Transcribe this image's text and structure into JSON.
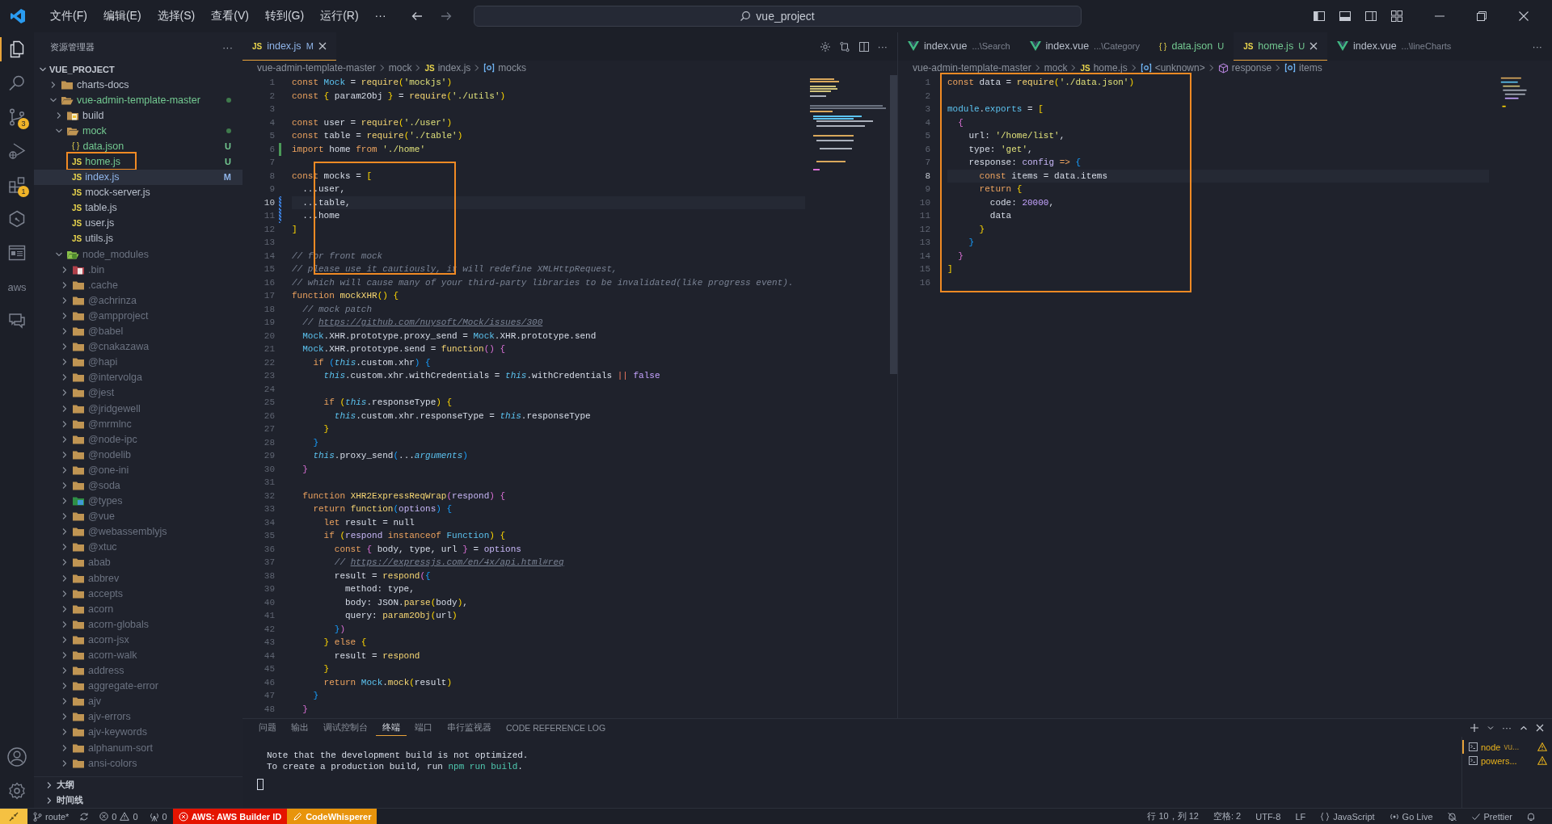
{
  "titlebar": {
    "menu": [
      {
        "label": "文件(F)"
      },
      {
        "label": "编辑(E)"
      },
      {
        "label": "选择(S)"
      },
      {
        "label": "查看(V)"
      },
      {
        "label": "转到(G)"
      },
      {
        "label": "运行(R)"
      },
      {
        "label": "···"
      }
    ],
    "command_center": "vue_project"
  },
  "activity": [
    {
      "kind": "files",
      "selected": true
    },
    {
      "kind": "search",
      "selected": false
    },
    {
      "kind": "source-control",
      "badge": "3",
      "selected": false
    },
    {
      "kind": "run",
      "selected": false
    },
    {
      "kind": "extensions",
      "badge": "1",
      "selected": false
    },
    {
      "kind": "hexagon",
      "selected": false
    },
    {
      "kind": "layout",
      "selected": false
    },
    {
      "kind": "aws",
      "label": "aws",
      "selected": false
    },
    {
      "kind": "chat",
      "selected": false
    }
  ],
  "activity_bottom": [
    {
      "kind": "account"
    },
    {
      "kind": "settings"
    }
  ],
  "sidebar": {
    "title": "资源管理器",
    "more": "···",
    "project": {
      "name": "VUE_PROJECT",
      "expanded": true
    },
    "tree": [
      {
        "name": "charts-docs",
        "kind": "folder",
        "expanded": false,
        "color": "#b8bfcb",
        "selected": false
      },
      {
        "name": "vue-admin-template-master",
        "kind": "folder",
        "expanded": true,
        "color": "#73c991",
        "dot": true,
        "selected": false,
        "children": [
          {
            "name": "build",
            "kind": "folder-build",
            "expanded": false,
            "color": "#b8bfcb",
            "selected": false
          },
          {
            "name": "mock",
            "kind": "folder",
            "expanded": true,
            "color": "#73c991",
            "dot": true,
            "selected": false,
            "children": [
              {
                "name": "data.json",
                "kind": "file",
                "glyph": "{ }",
                "color": "#73c991",
                "badge": "U",
                "selected": false
              },
              {
                "name": "home.js",
                "kind": "file",
                "glyph": "JS",
                "color": "#73c991",
                "badge": "U",
                "selected": false,
                "highlighted": true
              },
              {
                "name": "index.js",
                "kind": "file",
                "glyph": "JS",
                "color": "#8fb4e8",
                "badge": "M",
                "selected": true
              },
              {
                "name": "mock-server.js",
                "kind": "file",
                "glyph": "JS",
                "color": "#b8bfcb",
                "selected": false
              },
              {
                "name": "table.js",
                "kind": "file",
                "glyph": "JS",
                "color": "#b8bfcb",
                "selected": false
              },
              {
                "name": "user.js",
                "kind": "file",
                "glyph": "JS",
                "color": "#b8bfcb",
                "selected": false
              },
              {
                "name": "utils.js",
                "kind": "file",
                "glyph": "JS",
                "color": "#b8bfcb",
                "selected": false
              }
            ]
          },
          {
            "name": "node_modules",
            "kind": "folder-node",
            "expanded": true,
            "color": "#6b7280",
            "selected": false,
            "children": [
              {
                "name": ".bin",
                "kind": "folder-bin",
                "expanded": false,
                "color": "#6b7280",
                "selected": false
              },
              {
                "name": ".cache",
                "kind": "folder",
                "expanded": false,
                "color": "#6b7280",
                "selected": false
              },
              {
                "name": "@achrinza",
                "kind": "folder",
                "expanded": false,
                "color": "#6b7280",
                "selected": false
              },
              {
                "name": "@ampproject",
                "kind": "folder",
                "expanded": false,
                "color": "#6b7280",
                "selected": false
              },
              {
                "name": "@babel",
                "kind": "folder",
                "expanded": false,
                "color": "#6b7280",
                "selected": false
              },
              {
                "name": "@cnakazawa",
                "kind": "folder",
                "expanded": false,
                "color": "#6b7280",
                "selected": false
              },
              {
                "name": "@hapi",
                "kind": "folder",
                "expanded": false,
                "color": "#6b7280",
                "selected": false
              },
              {
                "name": "@intervolga",
                "kind": "folder",
                "expanded": false,
                "color": "#6b7280",
                "selected": false
              },
              {
                "name": "@jest",
                "kind": "folder",
                "expanded": false,
                "color": "#6b7280",
                "selected": false
              },
              {
                "name": "@jridgewell",
                "kind": "folder",
                "expanded": false,
                "color": "#6b7280",
                "selected": false
              },
              {
                "name": "@mrmlnc",
                "kind": "folder",
                "expanded": false,
                "color": "#6b7280",
                "selected": false
              },
              {
                "name": "@node-ipc",
                "kind": "folder",
                "expanded": false,
                "color": "#6b7280",
                "selected": false
              },
              {
                "name": "@nodelib",
                "kind": "folder",
                "expanded": false,
                "color": "#6b7280",
                "selected": false
              },
              {
                "name": "@one-ini",
                "kind": "folder",
                "expanded": false,
                "color": "#6b7280",
                "selected": false
              },
              {
                "name": "@soda",
                "kind": "folder",
                "expanded": false,
                "color": "#6b7280",
                "selected": false
              },
              {
                "name": "@types",
                "kind": "folder-ts",
                "expanded": false,
                "color": "#6b7280",
                "selected": false
              },
              {
                "name": "@vue",
                "kind": "folder",
                "expanded": false,
                "color": "#6b7280",
                "selected": false
              },
              {
                "name": "@webassemblyjs",
                "kind": "folder",
                "expanded": false,
                "color": "#6b7280",
                "selected": false
              },
              {
                "name": "@xtuc",
                "kind": "folder",
                "expanded": false,
                "color": "#6b7280",
                "selected": false
              },
              {
                "name": "abab",
                "kind": "folder",
                "expanded": false,
                "color": "#6b7280",
                "selected": false
              },
              {
                "name": "abbrev",
                "kind": "folder",
                "expanded": false,
                "color": "#6b7280",
                "selected": false
              },
              {
                "name": "accepts",
                "kind": "folder",
                "expanded": false,
                "color": "#6b7280",
                "selected": false
              },
              {
                "name": "acorn",
                "kind": "folder",
                "expanded": false,
                "color": "#6b7280",
                "selected": false
              },
              {
                "name": "acorn-globals",
                "kind": "folder",
                "expanded": false,
                "color": "#6b7280",
                "selected": false
              },
              {
                "name": "acorn-jsx",
                "kind": "folder",
                "expanded": false,
                "color": "#6b7280",
                "selected": false
              },
              {
                "name": "acorn-walk",
                "kind": "folder",
                "expanded": false,
                "color": "#6b7280",
                "selected": false
              },
              {
                "name": "address",
                "kind": "folder",
                "expanded": false,
                "color": "#6b7280",
                "selected": false
              },
              {
                "name": "aggregate-error",
                "kind": "folder",
                "expanded": false,
                "color": "#6b7280",
                "selected": false
              },
              {
                "name": "ajv",
                "kind": "folder",
                "expanded": false,
                "color": "#6b7280",
                "selected": false
              },
              {
                "name": "ajv-errors",
                "kind": "folder",
                "expanded": false,
                "color": "#6b7280",
                "selected": false
              },
              {
                "name": "ajv-keywords",
                "kind": "folder",
                "expanded": false,
                "color": "#6b7280",
                "selected": false
              },
              {
                "name": "alphanum-sort",
                "kind": "folder",
                "expanded": false,
                "color": "#6b7280",
                "selected": false
              },
              {
                "name": "ansi-colors",
                "kind": "folder",
                "expanded": false,
                "color": "#6b7280",
                "selected": false
              }
            ]
          }
        ]
      }
    ],
    "sections": [
      {
        "label": "大纲",
        "expanded": false
      },
      {
        "label": "时间线",
        "expanded": false
      }
    ]
  },
  "editors": [
    {
      "tabs": [
        {
          "glyph": "JS",
          "label": "index.js",
          "badge": "M",
          "color": "#8fb4e8",
          "selected": true
        }
      ],
      "more": "···",
      "breadcrumbs": [
        {
          "kind": "folder",
          "text": "vue-admin-template-master"
        },
        {
          "kind": "folder",
          "text": "mock"
        },
        {
          "kind": "file",
          "glyph": "JS",
          "text": "index.js"
        },
        {
          "kind": "symbol",
          "text": "mocks"
        }
      ],
      "highlight_box": true,
      "lines": [
        {
          "number": "1",
          "current": false,
          "tokens": [
            {
              "text": "const ",
              "kind": "kw"
            },
            {
              "text": "Mock",
              "kind": "cls"
            },
            {
              "text": " = ",
              "kind": "id"
            },
            {
              "text": "require",
              "kind": "fn"
            },
            {
              "text": "(",
              "kind": "b1"
            },
            {
              "text": "'mockjs'",
              "kind": "str"
            },
            {
              "text": ")",
              "kind": "b1"
            }
          ]
        },
        {
          "number": "2",
          "current": false,
          "tokens": [
            {
              "text": "const ",
              "kind": "kw"
            },
            {
              "text": "{",
              "kind": "b1"
            },
            {
              "text": " param2Obj ",
              "kind": "id"
            },
            {
              "text": "}",
              "kind": "b1"
            },
            {
              "text": " = ",
              "kind": "id"
            },
            {
              "text": "require",
              "kind": "fn"
            },
            {
              "text": "(",
              "kind": "b1"
            },
            {
              "text": "'./utils'",
              "kind": "str"
            },
            {
              "text": ")",
              "kind": "b1"
            }
          ]
        },
        {
          "number": "3",
          "current": false
        },
        {
          "number": "4",
          "current": false,
          "tokens": [
            {
              "text": "const ",
              "kind": "kw"
            },
            {
              "text": "user = ",
              "kind": "id"
            },
            {
              "text": "require",
              "kind": "fn"
            },
            {
              "text": "(",
              "kind": "b1"
            },
            {
              "text": "'./user'",
              "kind": "str"
            },
            {
              "text": ")",
              "kind": "b1"
            }
          ]
        },
        {
          "number": "5",
          "current": false,
          "tokens": [
            {
              "text": "const ",
              "kind": "kw"
            },
            {
              "text": "table = ",
              "kind": "id"
            },
            {
              "text": "require",
              "kind": "fn"
            },
            {
              "text": "(",
              "kind": "b1"
            },
            {
              "text": "'./table'",
              "kind": "str"
            },
            {
              "text": ")",
              "kind": "b1"
            }
          ]
        },
        {
          "number": "6",
          "current": false,
          "added": true,
          "tokens": [
            {
              "text": "import ",
              "kind": "kw"
            },
            {
              "text": "home ",
              "kind": "id"
            },
            {
              "text": "from ",
              "kind": "kw"
            },
            {
              "text": "'./home'",
              "kind": "str"
            }
          ]
        },
        {
          "number": "7",
          "current": false
        },
        {
          "number": "8",
          "current": false,
          "tokens": [
            {
              "text": "const ",
              "kind": "kw"
            },
            {
              "text": "mocks = ",
              "kind": "id"
            },
            {
              "text": "[",
              "kind": "b1"
            }
          ]
        },
        {
          "number": "9",
          "current": false,
          "tokens": [
            {
              "text": "  ...user,",
              "kind": "id"
            }
          ]
        },
        {
          "number": "10",
          "current": true,
          "modified": true,
          "tokens": [
            {
              "text": "  ...table,",
              "kind": "id"
            }
          ]
        },
        {
          "number": "11",
          "current": false,
          "modified": true,
          "tokens": [
            {
              "text": "  ...home",
              "kind": "id"
            }
          ]
        },
        {
          "number": "12",
          "current": false,
          "tokens": [
            {
              "text": "]",
              "kind": "b1"
            }
          ]
        },
        {
          "number": "13",
          "current": false
        },
        {
          "number": "14",
          "current": false,
          "tokens": [
            {
              "text": "// for front mock",
              "kind": "cmt"
            }
          ]
        },
        {
          "number": "15",
          "current": false,
          "tokens": [
            {
              "text": "// please use it cautiously, it will redefine XMLHttpRequest,",
              "kind": "cmt"
            }
          ]
        },
        {
          "number": "16",
          "current": false,
          "tokens": [
            {
              "text": "// which will cause many of your third-party libraries to be invalidated(like progress event).",
              "kind": "cmt"
            }
          ]
        },
        {
          "number": "17",
          "current": false,
          "tokens": [
            {
              "text": "function ",
              "kind": "kw"
            },
            {
              "text": "mockXHR",
              "kind": "fn"
            },
            {
              "text": "() {",
              "kind": "b1"
            }
          ]
        },
        {
          "number": "18",
          "current": false,
          "tokens": [
            {
              "text": "  // mock patch",
              "kind": "cmt"
            }
          ]
        },
        {
          "number": "19",
          "current": false,
          "tokens": [
            {
              "text": "  // ",
              "kind": "cmt"
            },
            {
              "text": "https://github.com/nuysoft/Mock/issues/300",
              "kind": "link"
            }
          ]
        },
        {
          "number": "20",
          "current": false,
          "tokens": [
            {
              "text": "  Mock",
              "kind": "cls"
            },
            {
              "text": ".XHR.prototype.proxy_send = ",
              "kind": "id"
            },
            {
              "text": "Mock",
              "kind": "cls"
            },
            {
              "text": ".XHR.prototype.send",
              "kind": "id"
            }
          ]
        },
        {
          "number": "21",
          "current": false,
          "tokens": [
            {
              "text": "  Mock",
              "kind": "cls"
            },
            {
              "text": ".XHR.prototype.send = ",
              "kind": "id"
            },
            {
              "text": "function",
              "kind": "fn"
            },
            {
              "text": "() {",
              "kind": "b2"
            }
          ]
        },
        {
          "number": "22",
          "current": false,
          "tokens": [
            {
              "text": "    if ",
              "kind": "kw"
            },
            {
              "text": "(",
              "kind": "b3"
            },
            {
              "text": "this",
              "kind": "this"
            },
            {
              "text": ".custom.xhr",
              "kind": "id"
            },
            {
              "text": ") {",
              "kind": "b3"
            }
          ]
        },
        {
          "number": "23",
          "current": false,
          "tokens": [
            {
              "text": "      this",
              "kind": "this"
            },
            {
              "text": ".custom.xhr.withCredentials = ",
              "kind": "id"
            },
            {
              "text": "this",
              "kind": "this"
            },
            {
              "text": ".withCredentials ",
              "kind": "id"
            },
            {
              "text": "||",
              "kind": "op"
            },
            {
              "text": " false",
              "kind": "num"
            }
          ]
        },
        {
          "number": "24",
          "current": false
        },
        {
          "number": "25",
          "current": false,
          "tokens": [
            {
              "text": "      if ",
              "kind": "kw"
            },
            {
              "text": "(",
              "kind": "b1"
            },
            {
              "text": "this",
              "kind": "this"
            },
            {
              "text": ".responseType",
              "kind": "id"
            },
            {
              "text": ") {",
              "kind": "b1"
            }
          ]
        },
        {
          "number": "26",
          "current": false,
          "tokens": [
            {
              "text": "        this",
              "kind": "this"
            },
            {
              "text": ".custom.xhr.responseType = ",
              "kind": "id"
            },
            {
              "text": "this",
              "kind": "this"
            },
            {
              "text": ".responseType",
              "kind": "id"
            }
          ]
        },
        {
          "number": "27",
          "current": false,
          "tokens": [
            {
              "text": "      }",
              "kind": "b1"
            }
          ]
        },
        {
          "number": "28",
          "current": false,
          "tokens": [
            {
              "text": "    }",
              "kind": "b3"
            }
          ]
        },
        {
          "number": "29",
          "current": false,
          "tokens": [
            {
              "text": "    this",
              "kind": "this"
            },
            {
              "text": ".proxy_send",
              "kind": "id"
            },
            {
              "text": "(",
              "kind": "b3"
            },
            {
              "text": "...",
              "kind": "id"
            },
            {
              "text": "arguments",
              "kind": "this"
            },
            {
              "text": ")",
              "kind": "b3"
            }
          ]
        },
        {
          "number": "30",
          "current": false,
          "tokens": [
            {
              "text": "  }",
              "kind": "b2"
            }
          ]
        },
        {
          "number": "31",
          "current": false
        },
        {
          "number": "32",
          "current": false,
          "tokens": [
            {
              "text": "  function ",
              "kind": "kw"
            },
            {
              "text": "XHR2ExpressReqWrap",
              "kind": "fn"
            },
            {
              "text": "(",
              "kind": "b2"
            },
            {
              "text": "respond",
              "kind": "param"
            },
            {
              "text": ") {",
              "kind": "b2"
            }
          ]
        },
        {
          "number": "33",
          "current": false,
          "tokens": [
            {
              "text": "    return ",
              "kind": "kw"
            },
            {
              "text": "function",
              "kind": "fn"
            },
            {
              "text": "(",
              "kind": "b3"
            },
            {
              "text": "options",
              "kind": "param"
            },
            {
              "text": ") {",
              "kind": "b3"
            }
          ]
        },
        {
          "number": "34",
          "current": false,
          "tokens": [
            {
              "text": "      let ",
              "kind": "kw"
            },
            {
              "text": "result = null",
              "kind": "id"
            }
          ]
        },
        {
          "number": "35",
          "current": false,
          "tokens": [
            {
              "text": "      if ",
              "kind": "kw"
            },
            {
              "text": "(",
              "kind": "b1"
            },
            {
              "text": "respond ",
              "kind": "param"
            },
            {
              "text": "instanceof ",
              "kind": "kw"
            },
            {
              "text": "Function",
              "kind": "cls"
            },
            {
              "text": ") {",
              "kind": "b1"
            }
          ]
        },
        {
          "number": "36",
          "current": false,
          "tokens": [
            {
              "text": "        const ",
              "kind": "kw"
            },
            {
              "text": "{",
              "kind": "b2"
            },
            {
              "text": " body, type, url ",
              "kind": "id"
            },
            {
              "text": "}",
              "kind": "b2"
            },
            {
              "text": " = ",
              "kind": "id"
            },
            {
              "text": "options",
              "kind": "param"
            }
          ]
        },
        {
          "number": "37",
          "current": false,
          "tokens": [
            {
              "text": "        // ",
              "kind": "cmt"
            },
            {
              "text": "https://expressjs.com/en/4x/api.html#req",
              "kind": "link"
            }
          ]
        },
        {
          "number": "38",
          "current": false,
          "tokens": [
            {
              "text": "        result = ",
              "kind": "id"
            },
            {
              "text": "respond",
              "kind": "fn"
            },
            {
              "text": "(",
              "kind": "b2"
            },
            {
              "text": "{",
              "kind": "b3"
            }
          ]
        },
        {
          "number": "39",
          "current": false,
          "tokens": [
            {
              "text": "          method: type,",
              "kind": "id"
            }
          ]
        },
        {
          "number": "40",
          "current": false,
          "tokens": [
            {
              "text": "          body: JSON.",
              "kind": "id"
            },
            {
              "text": "parse",
              "kind": "fn"
            },
            {
              "text": "(",
              "kind": "b1"
            },
            {
              "text": "body",
              "kind": "id"
            },
            {
              "text": ")",
              "kind": "b1"
            },
            {
              "text": ",",
              "kind": "id"
            }
          ]
        },
        {
          "number": "41",
          "current": false,
          "tokens": [
            {
              "text": "          query: ",
              "kind": "id"
            },
            {
              "text": "param2Obj",
              "kind": "fn"
            },
            {
              "text": "(",
              "kind": "b1"
            },
            {
              "text": "url",
              "kind": "id"
            },
            {
              "text": ")",
              "kind": "b1"
            }
          ]
        },
        {
          "number": "42",
          "current": false,
          "tokens": [
            {
              "text": "        }",
              "kind": "b3"
            },
            {
              "text": ")",
              "kind": "b2"
            }
          ]
        },
        {
          "number": "43",
          "current": false,
          "tokens": [
            {
              "text": "      } ",
              "kind": "b1"
            },
            {
              "text": "else ",
              "kind": "kw"
            },
            {
              "text": "{",
              "kind": "b1"
            }
          ]
        },
        {
          "number": "44",
          "current": false,
          "tokens": [
            {
              "text": "        result = ",
              "kind": "id"
            },
            {
              "text": "respond",
              "kind": "fn"
            }
          ]
        },
        {
          "number": "45",
          "current": false,
          "tokens": [
            {
              "text": "      }",
              "kind": "b1"
            }
          ]
        },
        {
          "number": "46",
          "current": false,
          "tokens": [
            {
              "text": "      return ",
              "kind": "kw"
            },
            {
              "text": "Mock",
              "kind": "cls"
            },
            {
              "text": ".",
              "kind": "id"
            },
            {
              "text": "mock",
              "kind": "fn"
            },
            {
              "text": "(",
              "kind": "b1"
            },
            {
              "text": "result",
              "kind": "id"
            },
            {
              "text": ")",
              "kind": "b1"
            }
          ]
        },
        {
          "number": "47",
          "current": false,
          "tokens": [
            {
              "text": "    }",
              "kind": "b3"
            }
          ]
        },
        {
          "number": "48",
          "current": false,
          "tokens": [
            {
              "text": "  }",
              "kind": "b2"
            }
          ]
        }
      ]
    },
    {
      "tabs": [
        {
          "kind": "vue",
          "label": "index.vue",
          "description": "...\\Search",
          "color": "#b8bfcb",
          "selected": false
        },
        {
          "kind": "vue",
          "label": "index.vue",
          "description": "...\\Category",
          "color": "#b8bfcb",
          "selected": false
        },
        {
          "kind": "file",
          "glyph": "{ }",
          "label": "data.json",
          "badge": "U",
          "color": "#73c991",
          "selected": false
        },
        {
          "kind": "file",
          "glyph": "JS",
          "label": "home.js",
          "badge": "U",
          "color": "#73c991",
          "selected": true
        },
        {
          "kind": "vue",
          "label": "index.vue",
          "description": "...\\lineCharts",
          "color": "#b8bfcb",
          "selected": false
        }
      ],
      "more": "···",
      "breadcrumbs": [
        {
          "kind": "folder",
          "text": "vue-admin-template-master"
        },
        {
          "kind": "folder",
          "text": "mock"
        },
        {
          "kind": "file",
          "glyph": "JS",
          "text": "home.js"
        },
        {
          "kind": "symbol",
          "text": "<unknown>"
        },
        {
          "kind": "method",
          "text": "response"
        },
        {
          "kind": "symbol",
          "text": "items"
        }
      ],
      "highlight_box": true,
      "lines": [
        {
          "number": "1",
          "current": false,
          "tokens": [
            {
              "text": "const ",
              "kind": "kw"
            },
            {
              "text": "data = ",
              "kind": "id"
            },
            {
              "text": "require",
              "kind": "fn"
            },
            {
              "text": "(",
              "kind": "b1"
            },
            {
              "text": "'./data.json'",
              "kind": "str"
            },
            {
              "text": ")",
              "kind": "b1"
            }
          ]
        },
        {
          "number": "2",
          "current": false
        },
        {
          "number": "3",
          "current": false,
          "tokens": [
            {
              "text": "module",
              "kind": "cls"
            },
            {
              "text": ".",
              "kind": "id"
            },
            {
              "text": "exports",
              "kind": "cls"
            },
            {
              "text": " = ",
              "kind": "id"
            },
            {
              "text": "[",
              "kind": "b1"
            }
          ]
        },
        {
          "number": "4",
          "current": false,
          "tokens": [
            {
              "text": "  {",
              "kind": "b2"
            }
          ]
        },
        {
          "number": "5",
          "current": false,
          "tokens": [
            {
              "text": "    url: ",
              "kind": "id"
            },
            {
              "text": "'/home/list'",
              "kind": "str"
            },
            {
              "text": ",",
              "kind": "id"
            }
          ]
        },
        {
          "number": "6",
          "current": false,
          "tokens": [
            {
              "text": "    type: ",
              "kind": "id"
            },
            {
              "text": "'get'",
              "kind": "str"
            },
            {
              "text": ",",
              "kind": "id"
            }
          ]
        },
        {
          "number": "7",
          "current": false,
          "tokens": [
            {
              "text": "    response: ",
              "kind": "id"
            },
            {
              "text": "config",
              "kind": "param"
            },
            {
              "text": " =>",
              "kind": "kw"
            },
            {
              "text": " {",
              "kind": "b3"
            }
          ]
        },
        {
          "number": "8",
          "current": true,
          "tokens": [
            {
              "text": "      const ",
              "kind": "kw"
            },
            {
              "text": "items = data.items",
              "kind": "id"
            }
          ]
        },
        {
          "number": "9",
          "current": false,
          "tokens": [
            {
              "text": "      return ",
              "kind": "kw"
            },
            {
              "text": "{",
              "kind": "b1"
            }
          ]
        },
        {
          "number": "10",
          "current": false,
          "tokens": [
            {
              "text": "        code: ",
              "kind": "id"
            },
            {
              "text": "20000",
              "kind": "num"
            },
            {
              "text": ",",
              "kind": "id"
            }
          ]
        },
        {
          "number": "11",
          "current": false,
          "tokens": [
            {
              "text": "        data",
              "kind": "id"
            }
          ]
        },
        {
          "number": "12",
          "current": false,
          "tokens": [
            {
              "text": "      }",
              "kind": "b1"
            }
          ]
        },
        {
          "number": "13",
          "current": false,
          "tokens": [
            {
              "text": "    }",
              "kind": "b3"
            }
          ]
        },
        {
          "number": "14",
          "current": false,
          "tokens": [
            {
              "text": "  }",
              "kind": "b2"
            }
          ]
        },
        {
          "number": "15",
          "current": false,
          "tokens": [
            {
              "text": "]",
              "kind": "b1"
            }
          ]
        },
        {
          "number": "16",
          "current": false
        }
      ]
    }
  ],
  "panel": {
    "tabs": [
      {
        "label": "问题",
        "selected": false
      },
      {
        "label": "输出",
        "selected": false
      },
      {
        "label": "调试控制台",
        "selected": false
      },
      {
        "label": "终端",
        "selected": true
      },
      {
        "label": "端口",
        "selected": false
      },
      {
        "label": "串行监视器",
        "selected": false
      },
      {
        "label": "CODE REFERENCE LOG",
        "selected": false
      }
    ],
    "more": "···",
    "terminal_lines": [
      [
        {
          "text": "Note that the development build is not optimized.",
          "kind": "plain"
        }
      ],
      [
        {
          "text": "To create a production build, run ",
          "kind": "plain"
        },
        {
          "text": "npm run build",
          "kind": "command"
        },
        {
          "text": ".",
          "kind": "plain"
        }
      ]
    ],
    "terminals": [
      {
        "label": "node",
        "description": "vu...",
        "selected": true
      },
      {
        "label": "powers...",
        "selected": false
      }
    ]
  },
  "status_bar": {
    "left": [
      {
        "kind": "remote"
      },
      {
        "kind": "branch",
        "text": "route*"
      },
      {
        "kind": "sync"
      },
      {
        "kind": "problems",
        "errors": "0",
        "warnings": "0"
      },
      {
        "kind": "ports",
        "text": "0"
      },
      {
        "kind": "aws",
        "text": "AWS: AWS Builder ID"
      },
      {
        "kind": "codewhisperer",
        "text": "CodeWhisperer"
      }
    ],
    "right": [
      {
        "kind": "text",
        "text": "行 10，列 12"
      },
      {
        "kind": "text",
        "text": "空格: 2"
      },
      {
        "kind": "text",
        "text": "UTF-8"
      },
      {
        "kind": "text",
        "text": "LF"
      },
      {
        "kind": "language",
        "text": "JavaScript"
      },
      {
        "kind": "golive",
        "text": "Go Live"
      },
      {
        "kind": "bell-off"
      },
      {
        "kind": "prettier",
        "text": "Prettier"
      },
      {
        "kind": "bell"
      }
    ]
  }
}
